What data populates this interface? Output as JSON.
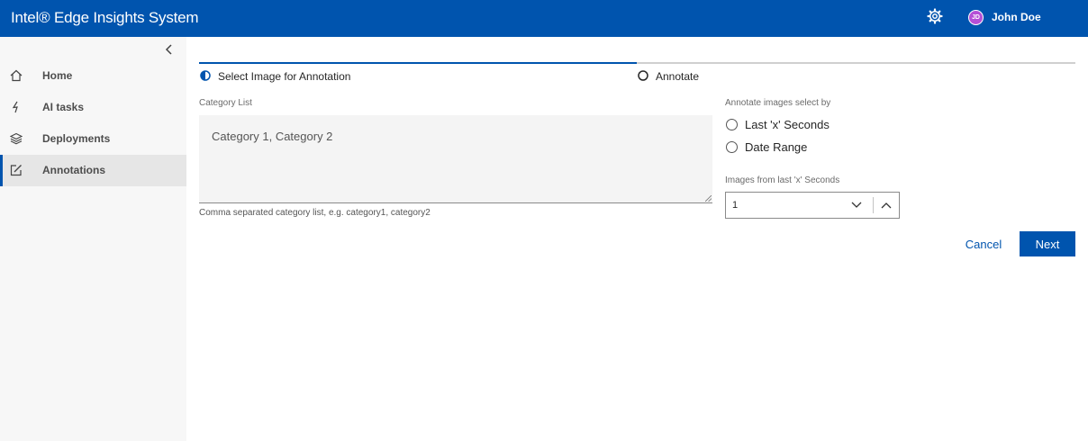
{
  "header": {
    "app_title": "Intel® Edge Insights System",
    "settings_icon": "gear-icon",
    "user_initials": "JD",
    "user_name": "John Doe",
    "avatar_color": "#b44fd6",
    "brand_color": "#0054ae"
  },
  "sidebar": {
    "collapse_icon": "chevron-left-icon",
    "items": [
      {
        "label": "Home",
        "icon": "home-icon",
        "active": false
      },
      {
        "label": "AI tasks",
        "icon": "lightning-icon",
        "active": false
      },
      {
        "label": "Deployments",
        "icon": "layers-icon",
        "active": false
      },
      {
        "label": "Annotations",
        "icon": "edit-icon",
        "active": true
      }
    ]
  },
  "stepper": {
    "steps": [
      {
        "label": "Select Image for Annotation",
        "state": "in-progress"
      },
      {
        "label": "Annotate",
        "state": "not-started"
      }
    ]
  },
  "form": {
    "category_list": {
      "label": "Category List",
      "value": "Category 1, Category 2",
      "help": "Comma separated category list, e.g. category1, category2"
    },
    "select_by": {
      "label": "Annotate images select by",
      "options": [
        "Last 'x' Seconds",
        "Date Range"
      ],
      "selected": null
    },
    "seconds": {
      "label": "Images from last 'x' Seconds",
      "value": "1"
    },
    "cancel_label": "Cancel",
    "next_label": "Next"
  }
}
